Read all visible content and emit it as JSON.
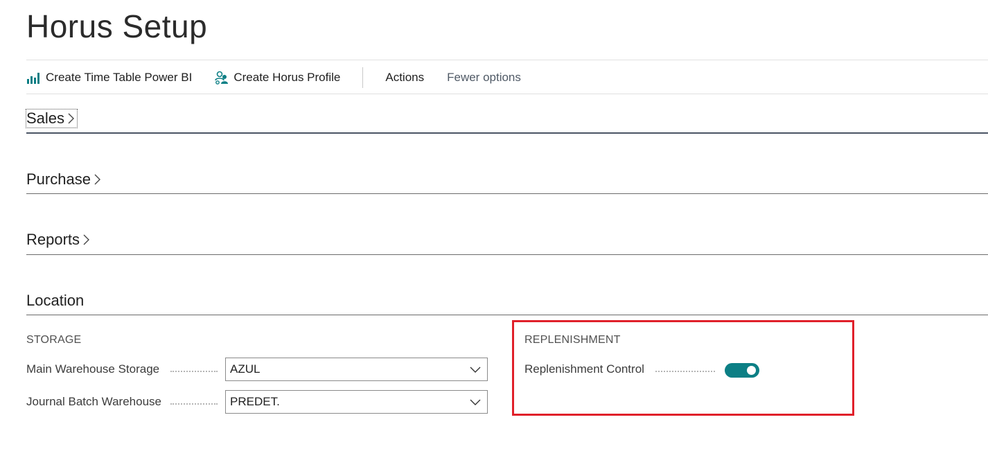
{
  "page": {
    "title": "Horus Setup"
  },
  "toolbar": {
    "create_time_table_label": "Create Time Table Power BI",
    "create_horus_profile_label": "Create Horus Profile",
    "actions_label": "Actions",
    "fewer_options_label": "Fewer options"
  },
  "sections": {
    "sales": "Sales",
    "purchase": "Purchase",
    "reports": "Reports",
    "location": "Location"
  },
  "location": {
    "storage_caption": "STORAGE",
    "main_warehouse_storage_label": "Main Warehouse Storage",
    "main_warehouse_storage_value": "AZUL",
    "journal_batch_warehouse_label": "Journal Batch Warehouse",
    "journal_batch_warehouse_value": "PREDET.",
    "replenishment_caption": "REPLENISHMENT",
    "replenishment_control_label": "Replenishment Control",
    "replenishment_control_on": true
  },
  "colors": {
    "accent": "#0c7f85",
    "highlight": "#e0202a"
  },
  "icons": {
    "power_bi": "bar-chart-icon",
    "profile": "users-icon",
    "chevron": "chevron-right-icon",
    "dropdown": "chevron-down-icon"
  }
}
